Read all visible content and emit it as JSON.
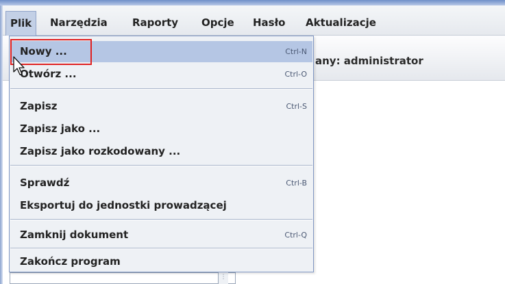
{
  "menubar": {
    "items": [
      {
        "label": "Plik",
        "active": true
      },
      {
        "label": "Narzędzia"
      },
      {
        "label": "Raporty"
      },
      {
        "label": "Opcje"
      },
      {
        "label": "Hasło"
      },
      {
        "label": "Aktualizacje"
      }
    ]
  },
  "status": {
    "user_label": "any: administrator"
  },
  "dropdown": {
    "items": [
      {
        "label": "Nowy ...",
        "shortcut": "Ctrl-N",
        "highlighted": true
      },
      {
        "label": "Otwórz ...",
        "shortcut": "Ctrl-O"
      },
      {
        "label": "Zapisz",
        "shortcut": "Ctrl-S"
      },
      {
        "label": "Zapisz jako ...",
        "shortcut": ""
      },
      {
        "label": "Zapisz jako rozkodowany ...",
        "shortcut": ""
      },
      {
        "label": "Sprawdź",
        "shortcut": "Ctrl-B"
      },
      {
        "label": "Eksportuj do jednostki prowadzącej",
        "shortcut": ""
      },
      {
        "label": "Zamknij dokument",
        "shortcut": "Ctrl-Q"
      },
      {
        "label": "Zakończ program",
        "shortcut": ""
      }
    ]
  },
  "colors": {
    "menu_background": "#eef1f5",
    "highlight": "#b5c6e4",
    "annotation": "#e02020",
    "menu_border": "#7f96c3"
  },
  "icons": {
    "cursor": "arrow-pointer-icon"
  }
}
